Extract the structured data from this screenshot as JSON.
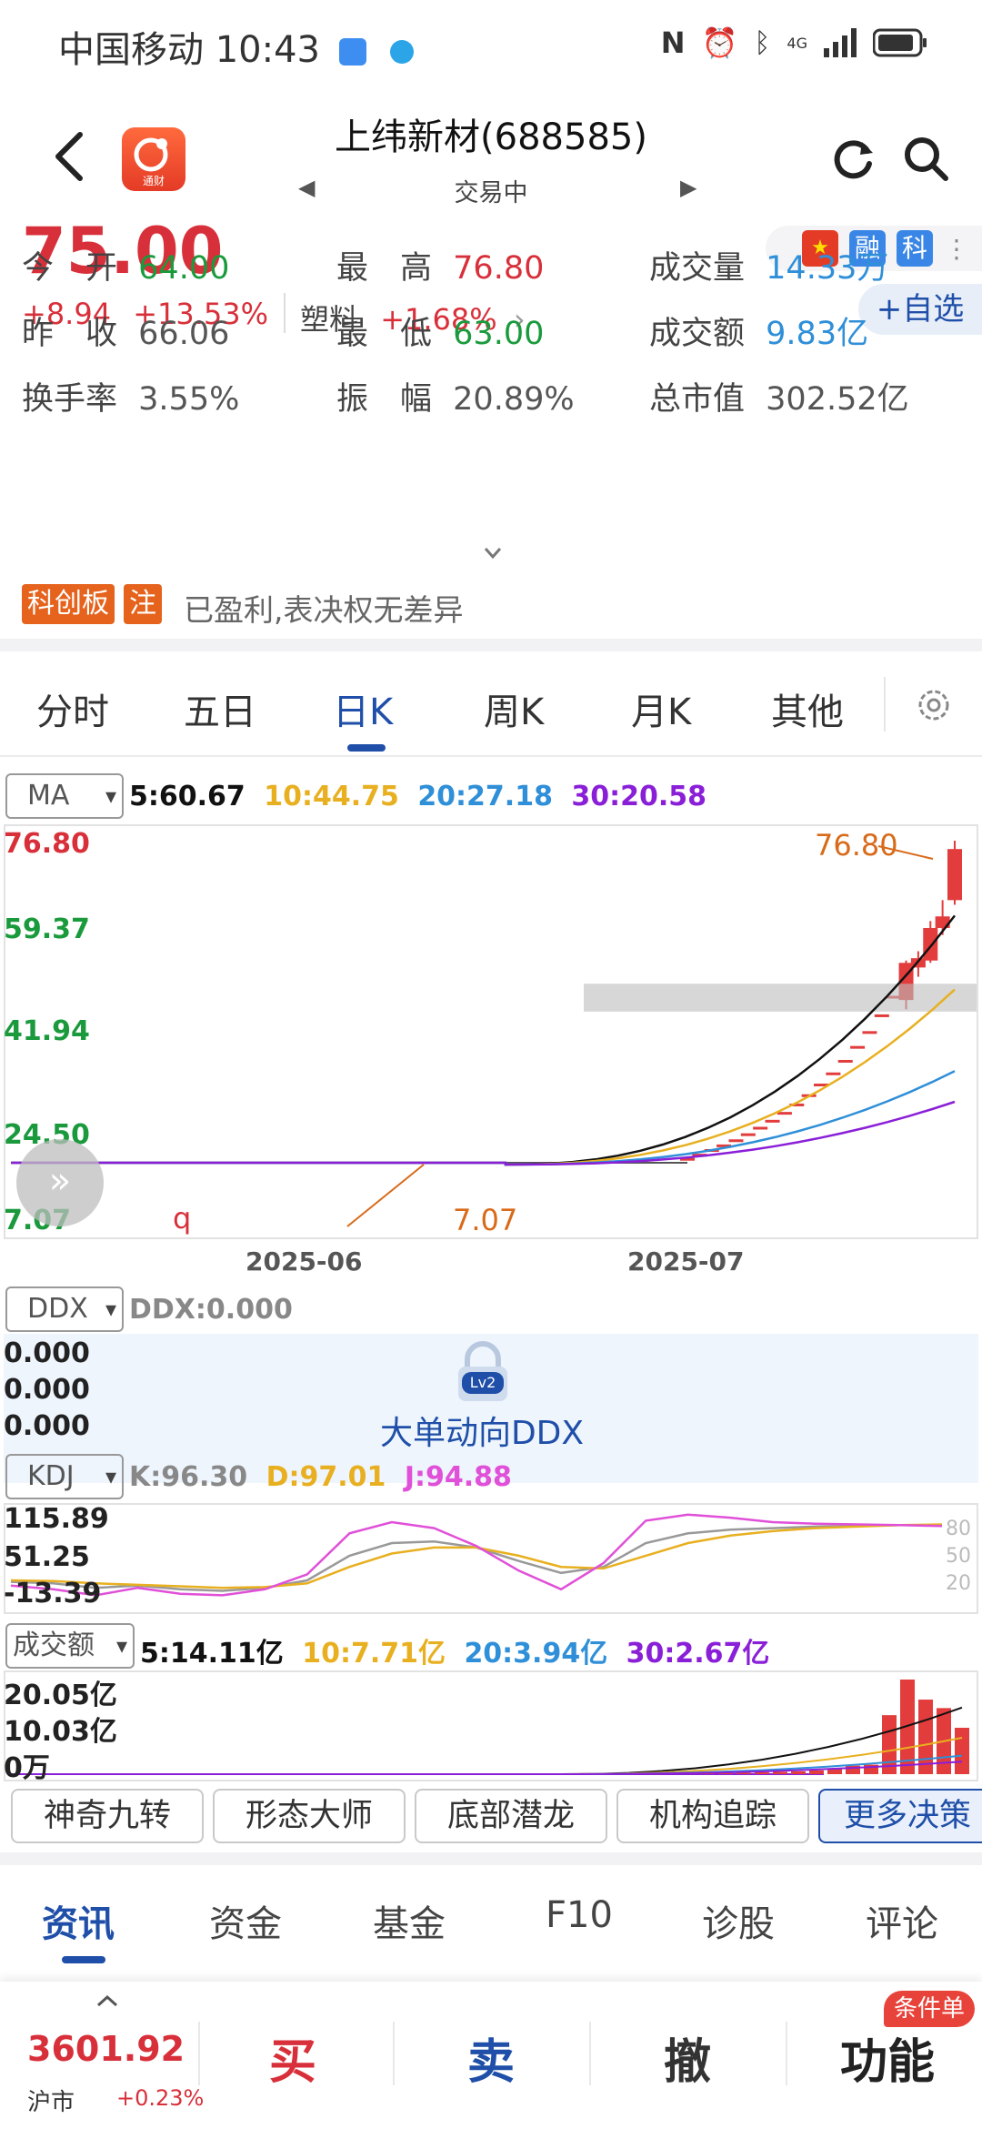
{
  "status_bar": {
    "carrier": "中国移动",
    "time": "10:43",
    "network": "4G"
  },
  "header": {
    "title": "上纬新材(688585)",
    "trading_status": "交易中",
    "logo_text": "通财"
  },
  "quote": {
    "price": "75.00",
    "change": "+8.94",
    "change_pct": "+13.53%",
    "sector_name": "塑料",
    "sector_change": "+1.68%",
    "badges": [
      "融",
      "科"
    ],
    "add_watch": "+自选"
  },
  "stats": {
    "open_label": "今　开",
    "open": "64.00",
    "high_label": "最　高",
    "high": "76.80",
    "volume_label": "成交量",
    "volume": "14.33万",
    "prev_close_label": "昨　收",
    "prev_close": "66.06",
    "low_label": "最　低",
    "low": "63.00",
    "amount_label": "成交额",
    "amount": "9.83亿",
    "turnover_label": "换手率",
    "turnover": "3.55%",
    "amplitude_label": "振　幅",
    "amplitude": "20.89%",
    "mkt_cap_label": "总市值",
    "mkt_cap": "302.52亿"
  },
  "notice": {
    "tag1": "科创板",
    "tag2": "注",
    "text": "已盈利,表决权无差异"
  },
  "period_tabs": [
    "分时",
    "五日",
    "日K",
    "周K",
    "月K",
    "其他"
  ],
  "active_period": "日K",
  "ma": {
    "selector": "MA",
    "ma5": "5:60.67",
    "ma10": "10:44.75",
    "ma20": "20:27.18",
    "ma30": "30:20.58",
    "colors": {
      "ma5": "#111111",
      "ma10": "#e8b020",
      "ma20": "#2f8fd8",
      "ma30": "#8a1fd8"
    }
  },
  "kline": {
    "y_labels": [
      "76.80",
      "59.37",
      "41.94",
      "24.50",
      "7.07"
    ],
    "x_labels": [
      "2025-06",
      "2025-07"
    ],
    "high_annotation": "76.80",
    "low_annotation": "7.07",
    "marker_q": "q"
  },
  "ddx": {
    "selector": "DDX",
    "value": "DDX:0.000",
    "y_labels": [
      "0.000",
      "0.000",
      "0.000"
    ],
    "lock_badge": "Lv2",
    "caption": "大单动向DDX"
  },
  "kdj": {
    "selector": "KDJ",
    "k": "K:96.30",
    "d": "D:97.01",
    "j": "J:94.88",
    "y_labels": [
      "115.89",
      "51.25",
      "-13.39"
    ],
    "right_labels": [
      "80",
      "50",
      "20"
    ]
  },
  "turnover_ind": {
    "selector": "成交额",
    "ma5": "5:14.11亿",
    "ma10": "10:7.71亿",
    "ma20": "20:3.94亿",
    "ma30": "30:2.67亿",
    "y_labels": [
      "20.05亿",
      "10.03亿",
      "0万"
    ]
  },
  "tools": [
    "神奇九转",
    "形态大师",
    "底部潜龙",
    "机构追踪",
    "更多决策"
  ],
  "info_tabs": [
    "资讯",
    "资金",
    "基金",
    "F10",
    "诊股",
    "评论"
  ],
  "active_info_tab": "资讯",
  "bottom_bar": {
    "index_value": "3601.92",
    "index_name": "沪市",
    "index_change": "+0.23%",
    "buy": "买",
    "sell": "卖",
    "cancel": "撤",
    "function": "功能",
    "cond_badge": "条件单"
  },
  "chart_data": [
    {
      "type": "candlestick",
      "title": "",
      "x_labels": [
        "2025-06",
        "2025-07"
      ],
      "y_ticks": [
        76.8,
        59.37,
        41.94,
        24.5,
        7.07
      ],
      "ylim": [
        7.07,
        76.8
      ],
      "annotations": [
        {
          "text": "76.80",
          "kind": "high"
        },
        {
          "text": "7.07",
          "kind": "low"
        }
      ],
      "candles_recent": [
        {
          "o": 8.5,
          "c": 8.5,
          "h": 8.5,
          "l": 8.5
        },
        {
          "o": 9.4,
          "c": 9.4,
          "h": 9.4,
          "l": 9.4
        },
        {
          "o": 10.4,
          "c": 10.4,
          "h": 10.4,
          "l": 10.4
        },
        {
          "o": 11.4,
          "c": 11.4,
          "h": 11.4,
          "l": 11.4
        },
        {
          "o": 12.5,
          "c": 12.5,
          "h": 12.5,
          "l": 12.5
        },
        {
          "o": 13.8,
          "c": 13.8,
          "h": 13.8,
          "l": 13.8
        },
        {
          "o": 15.2,
          "c": 15.2,
          "h": 15.2,
          "l": 15.2
        },
        {
          "o": 16.7,
          "c": 16.7,
          "h": 16.7,
          "l": 16.7
        },
        {
          "o": 18.4,
          "c": 18.4,
          "h": 18.4,
          "l": 18.4
        },
        {
          "o": 20.2,
          "c": 20.2,
          "h": 20.2,
          "l": 20.2
        },
        {
          "o": 22.2,
          "c": 22.2,
          "h": 22.2,
          "l": 22.2
        },
        {
          "o": 24.5,
          "c": 24.5,
          "h": 24.5,
          "l": 24.5
        },
        {
          "o": 26.9,
          "c": 26.9,
          "h": 26.9,
          "l": 26.9
        },
        {
          "o": 29.6,
          "c": 29.6,
          "h": 29.6,
          "l": 29.6
        },
        {
          "o": 32.6,
          "c": 32.6,
          "h": 32.6,
          "l": 32.6
        },
        {
          "o": 35.8,
          "c": 35.8,
          "h": 35.8,
          "l": 35.8
        },
        {
          "o": 39.4,
          "c": 39.4,
          "h": 39.4,
          "l": 39.4
        },
        {
          "o": 43.4,
          "c": 43.4,
          "h": 43.4,
          "l": 43.4
        },
        {
          "o": 42.5,
          "c": 50.5,
          "h": 51.0,
          "l": 40.5
        },
        {
          "o": 49.5,
          "c": 51.5,
          "h": 53.0,
          "l": 47.5
        },
        {
          "o": 51.0,
          "c": 58.0,
          "h": 59.5,
          "l": 50.5
        },
        {
          "o": 58.0,
          "c": 60.5,
          "h": 64.0,
          "l": 56.5
        },
        {
          "o": 64.0,
          "c": 75.0,
          "h": 76.8,
          "l": 63.0
        }
      ],
      "ma_series": [
        {
          "name": "5",
          "value": 60.67
        },
        {
          "name": "10",
          "value": 44.75
        },
        {
          "name": "20",
          "value": 27.18
        },
        {
          "name": "30",
          "value": 20.58
        }
      ]
    },
    {
      "type": "line",
      "title": "KDJ",
      "y_ticks": [
        115.89,
        51.25,
        -13.39
      ],
      "ylim": [
        -13.39,
        115.89
      ],
      "series": [
        {
          "name": "K",
          "values": [
            20,
            18,
            12,
            15,
            10,
            8,
            12,
            22,
            55,
            72,
            74,
            66,
            48,
            32,
            40,
            72,
            85,
            90,
            92,
            94,
            95,
            96,
            96.3
          ]
        },
        {
          "name": "D",
          "values": [
            22,
            21,
            18,
            16,
            14,
            12,
            13,
            18,
            40,
            58,
            66,
            66,
            55,
            40,
            38,
            55,
            72,
            82,
            88,
            92,
            94,
            96,
            97.01
          ]
        },
        {
          "name": "J",
          "values": [
            15,
            10,
            2,
            12,
            4,
            2,
            10,
            30,
            85,
            100,
            92,
            68,
            35,
            10,
            45,
            102,
            110,
            106,
            100,
            98,
            97,
            96,
            94.88
          ]
        }
      ]
    },
    {
      "type": "bar",
      "title": "成交额",
      "y_ticks": [
        20.05,
        10.03,
        0
      ],
      "ylim": [
        0,
        20.05
      ],
      "unit": "亿",
      "values_recent": [
        0.1,
        0.1,
        0.1,
        0.1,
        0.1,
        0.1,
        0.2,
        0.2,
        0.2,
        0.3,
        0.3,
        0.4,
        0.5,
        0.6,
        0.8,
        1.2,
        1.8,
        2.0,
        12.5,
        20.05,
        15.8,
        14.0,
        9.83
      ],
      "ma_series": [
        {
          "name": "5",
          "value": 14.11
        },
        {
          "name": "10",
          "value": 7.71
        },
        {
          "name": "20",
          "value": 3.94
        },
        {
          "name": "30",
          "value": 2.67
        }
      ]
    }
  ]
}
